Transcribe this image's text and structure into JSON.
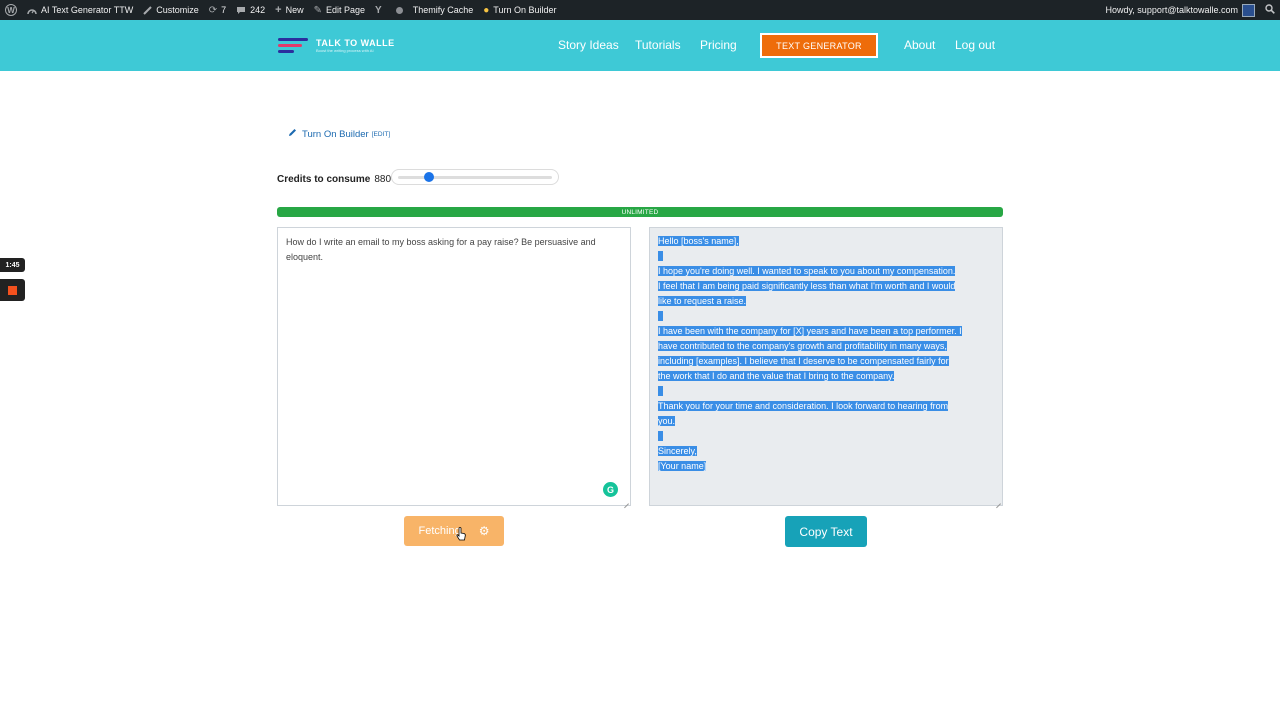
{
  "admin_bar": {
    "site_name": "AI Text Generator TTW",
    "customize": "Customize",
    "updates_count": "7",
    "comments_count": "242",
    "new_label": "New",
    "edit_page": "Edit Page",
    "cache_label": "Themify Cache",
    "builder_label": "Turn On Builder",
    "howdy": "Howdy, support@talktowalle.com"
  },
  "header": {
    "logo_text": "TALK TO WALLE",
    "logo_tagline": "Boost the writing process with AI",
    "nav": [
      "Story Ideas",
      "Tutorials",
      "Pricing",
      "About",
      "Log out"
    ],
    "cta": "TEXT GENERATOR"
  },
  "builder_link": {
    "label": "Turn On Builder",
    "edit": "[EDIT]"
  },
  "credits": {
    "label": "Credits to consume",
    "value": "880",
    "slider_fraction": 0.18
  },
  "progress": {
    "label": "UNLIMITED",
    "percent": 100,
    "color": "#28a745"
  },
  "prompt": {
    "text": "How do I write an email to my boss asking for a pay raise? Be persuasive and eloquent."
  },
  "output": {
    "lines": [
      "Hello [boss's name],",
      "",
      "I hope you're doing well. I wanted to speak to you about my compensation.",
      "I feel that I am being paid significantly less than what I'm worth and I would",
      "like to request a raise.",
      "",
      "I have been with the company for [X] years and have been a top performer. I",
      "have contributed to the company's growth and profitability in many ways,",
      "including [examples]. I believe that I deserve to be compensated fairly for",
      "the work that I do and the value that I bring to the company.",
      "",
      "Thank you for your time and consideration. I look forward to hearing from",
      "you.",
      "",
      "Sincerely,",
      "[Your name]"
    ]
  },
  "buttons": {
    "fetch": "Fetching",
    "copy": "Copy Text"
  },
  "recorder": {
    "time": "1:45"
  },
  "colors": {
    "header_bg": "#3ec9d6",
    "cta_bg": "#ee6c0a",
    "fetch_bg": "#f8b468",
    "copy_bg": "#17a2b8",
    "selection": "#3a8ee6"
  }
}
